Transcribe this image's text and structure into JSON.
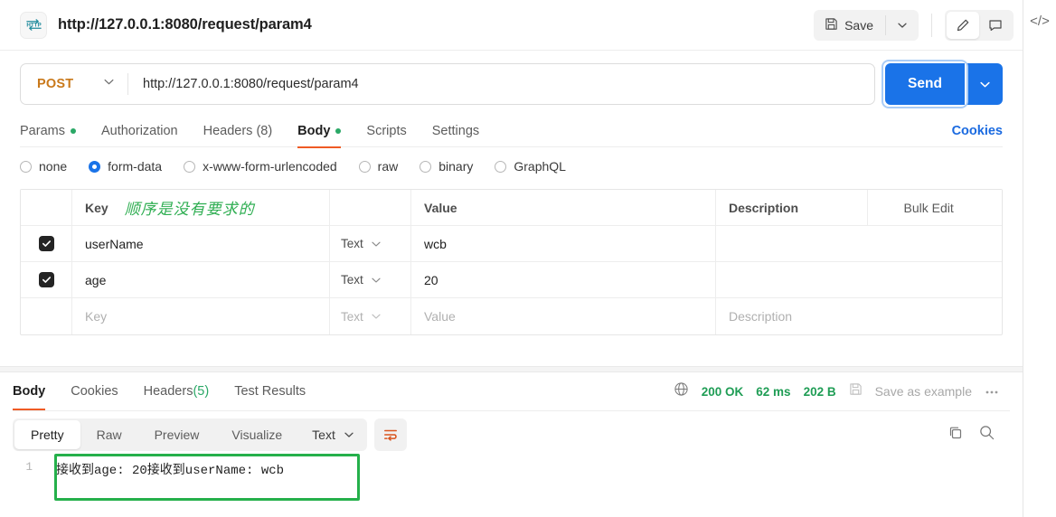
{
  "window": {
    "request_title": "http://127.0.0.1:8080/request/param4",
    "protocol_icon_label": "HTTP"
  },
  "toolbar": {
    "save_label": "Save",
    "save_icon": "floppy-disk-icon",
    "save_caret_icon": "chevron-down-icon",
    "edit_icon": "pencil-icon",
    "comment_icon": "comment-icon"
  },
  "right_rail": {
    "code_icon": "code-brackets-icon",
    "code_label": "</>"
  },
  "url_bar": {
    "method": "POST",
    "method_caret": "chevron-down-icon",
    "url": "http://127.0.0.1:8080/request/param4",
    "send_label": "Send",
    "send_caret": "chevron-down-icon"
  },
  "request_tabs": {
    "items": [
      {
        "label": "Params",
        "dot": true,
        "active": false
      },
      {
        "label": "Authorization",
        "dot": false,
        "active": false
      },
      {
        "label": "Headers (8)",
        "dot": false,
        "active": false
      },
      {
        "label": "Body",
        "dot": true,
        "active": true
      },
      {
        "label": "Scripts",
        "dot": false,
        "active": false
      },
      {
        "label": "Settings",
        "dot": false,
        "active": false
      }
    ],
    "cookies_link": "Cookies"
  },
  "body_types": {
    "options": [
      {
        "label": "none",
        "selected": false
      },
      {
        "label": "form-data",
        "selected": true
      },
      {
        "label": "x-www-form-urlencoded",
        "selected": false
      },
      {
        "label": "raw",
        "selected": false
      },
      {
        "label": "binary",
        "selected": false
      },
      {
        "label": "GraphQL",
        "selected": false
      }
    ]
  },
  "kv_table": {
    "headers": {
      "key": "Key",
      "value": "Value",
      "description": "Description",
      "bulk_edit": "Bulk Edit",
      "more_icon": "ellipsis-icon"
    },
    "annotation_cn": "顺序是没有要求的",
    "rows": [
      {
        "checked": true,
        "key": "userName",
        "type": "Text",
        "value": "wcb",
        "description": ""
      },
      {
        "checked": true,
        "key": "age",
        "type": "Text",
        "value": "20",
        "description": ""
      }
    ],
    "placeholder_row": {
      "key": "Key",
      "type": "Text",
      "value": "Value",
      "description": "Description"
    }
  },
  "response": {
    "tabs": [
      {
        "label": "Body",
        "active": true
      },
      {
        "label": "Cookies",
        "active": false
      },
      {
        "label": "Headers ",
        "count": "(5)",
        "active": false
      },
      {
        "label": "Test Results",
        "active": false
      }
    ],
    "globe_icon": "globe-icon",
    "status": "200 OK",
    "time": "62 ms",
    "size": "202 B",
    "save_example_icon": "floppy-disk-icon",
    "save_example_label": "Save as example",
    "more_icon": "ellipsis-icon",
    "view_modes": [
      {
        "label": "Pretty",
        "active": true
      },
      {
        "label": "Raw",
        "active": false
      },
      {
        "label": "Preview",
        "active": false
      },
      {
        "label": "Visualize",
        "active": false
      }
    ],
    "format": "Text",
    "format_caret": "chevron-down-icon",
    "wrap_icon": "word-wrap-icon",
    "copy_icon": "copy-icon",
    "search_icon": "search-icon",
    "body_lines": [
      {
        "number": "1",
        "text": "接收到age: 20接收到userName: wcb"
      }
    ]
  },
  "colors": {
    "accent_blue": "#1a73e8",
    "method_orange": "#c9791b",
    "tab_underline": "#ef5b25",
    "status_green": "#1f9d55",
    "dot_green": "#2aa866",
    "annotation_green": "#25b04b"
  }
}
